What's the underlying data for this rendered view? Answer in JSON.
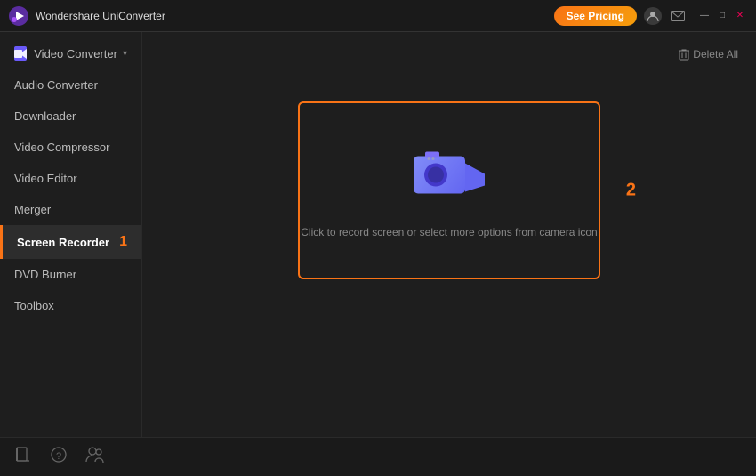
{
  "app": {
    "title": "Wondershare UniConverter",
    "logo_icon": "🎨"
  },
  "titlebar": {
    "see_pricing_label": "See Pricing",
    "account_icon": "user-icon",
    "mail_icon": "mail-icon",
    "minimize_icon": "—",
    "maximize_icon": "□",
    "close_icon": "✕"
  },
  "sidebar": {
    "items": [
      {
        "id": "video-converter",
        "label": "Video Converter",
        "active": false,
        "has_icon": true
      },
      {
        "id": "audio-converter",
        "label": "Audio Converter",
        "active": false
      },
      {
        "id": "downloader",
        "label": "Downloader",
        "active": false
      },
      {
        "id": "video-compressor",
        "label": "Video Compressor",
        "active": false
      },
      {
        "id": "video-editor",
        "label": "Video Editor",
        "active": false
      },
      {
        "id": "merger",
        "label": "Merger",
        "active": false
      },
      {
        "id": "screen-recorder",
        "label": "Screen Recorder",
        "active": true,
        "badge": "1"
      },
      {
        "id": "dvd-burner",
        "label": "DVD Burner",
        "active": false
      },
      {
        "id": "toolbox",
        "label": "Toolbox",
        "active": false
      }
    ]
  },
  "content": {
    "delete_all_label": "Delete All",
    "record_hint": "Click to record screen or select more options from camera icon",
    "area_badge": "2"
  },
  "bottom": {
    "icons": [
      "book-icon",
      "help-icon",
      "people-icon"
    ]
  }
}
